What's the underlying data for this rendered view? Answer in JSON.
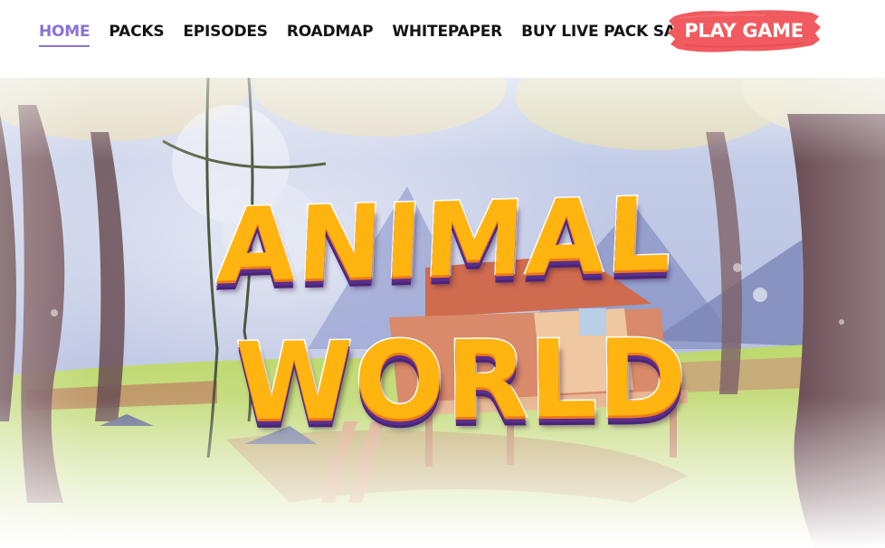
{
  "nav": {
    "items": [
      {
        "label": "HOME",
        "active": true
      },
      {
        "label": "PACKS",
        "active": false
      },
      {
        "label": "EPISODES",
        "active": false
      },
      {
        "label": "ROADMAP",
        "active": false
      },
      {
        "label": "WHITEPAPER",
        "active": false
      },
      {
        "label": "BUY LIVE PACK SALE",
        "active": false
      }
    ],
    "cta_label": "PLAY GAME"
  },
  "hero": {
    "logo_line1": "ANIMAL",
    "logo_line2": "WORLD"
  },
  "colors": {
    "active_nav": "#8a72d6",
    "cta_background": "#f15a5f",
    "logo_fill": "#ffb410",
    "logo_outline": "#5a2e8c"
  }
}
